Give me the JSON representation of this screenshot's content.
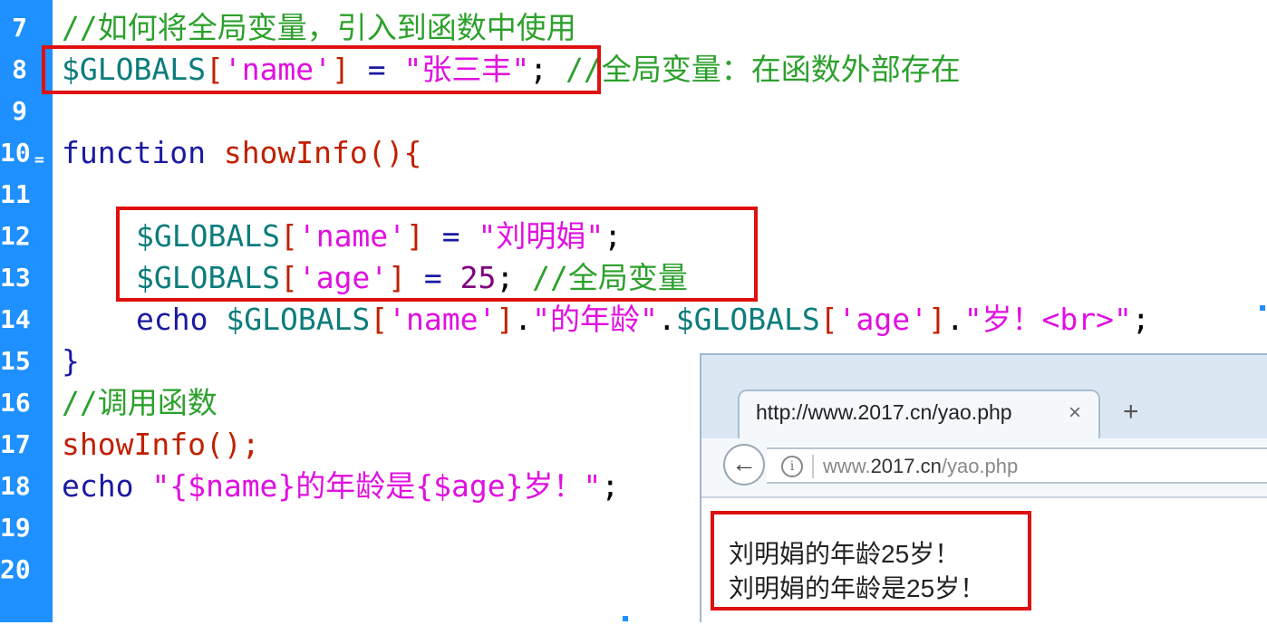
{
  "gutter": {
    "line_numbers": [
      "7",
      "8",
      "9",
      "10",
      "11",
      "12",
      "13",
      "14",
      "15",
      "16",
      "17",
      "18",
      "19",
      "20"
    ],
    "fold_marker": "="
  },
  "code": {
    "l7_comment": "//如何将全局变量，引入到函数中使用",
    "l8": {
      "var": "$GLOBALS",
      "b1": "[",
      "key": "'name'",
      "b2": "]",
      "op": " = ",
      "str": "\"张三丰\"",
      "semi": ";",
      "comment": " //全局变量：在函数外部存在"
    },
    "l10": {
      "kw": "function",
      "fn": " showInfo",
      "rest": "(){"
    },
    "l12": {
      "var": "$GLOBALS",
      "b1": "[",
      "key": "'name'",
      "b2": "]",
      "op": " = ",
      "str": "\"刘明娟\"",
      "semi": ";"
    },
    "l13": {
      "var": "$GLOBALS",
      "b1": "[",
      "key": "'age'",
      "b2": "]",
      "op": " = ",
      "num": "25",
      "semi": ";",
      "comment": " //全局变量"
    },
    "l14": {
      "kw": "echo",
      "var1": " $GLOBALS",
      "b1": "[",
      "key1": "'name'",
      "b2": "]",
      "dot1": ".",
      "str1": "\"的年龄\"",
      "dot2": ".",
      "var2": "$GLOBALS",
      "b3": "[",
      "key2": "'age'",
      "b4": "]",
      "dot3": ".",
      "str2": "\"岁！<br>\"",
      "semi": ";"
    },
    "l15": "}",
    "l16_comment": "//调用函数",
    "l17": {
      "fn": "showInfo",
      "rest": "();"
    },
    "l18": {
      "kw": "echo",
      "str": " \"{$name}的年龄是{$age}岁！\"",
      "semi": ";"
    }
  },
  "browser": {
    "tab_title": "http://www.2017.cn/yao.php",
    "tab_close": "×",
    "new_tab": "+",
    "back": "←",
    "info": "i",
    "url_prefix": "www.",
    "url_host": "2017.cn",
    "url_path": "/yao.php",
    "output": [
      "刘明娟的年龄25岁！",
      "刘明娟的年龄是25岁！"
    ]
  },
  "colors": {
    "gutter": "#1e90ff",
    "highlight_box": "#e01010",
    "comment": "#2ca02c",
    "string": "#e010e0",
    "keyword": "#1a1aa0"
  }
}
